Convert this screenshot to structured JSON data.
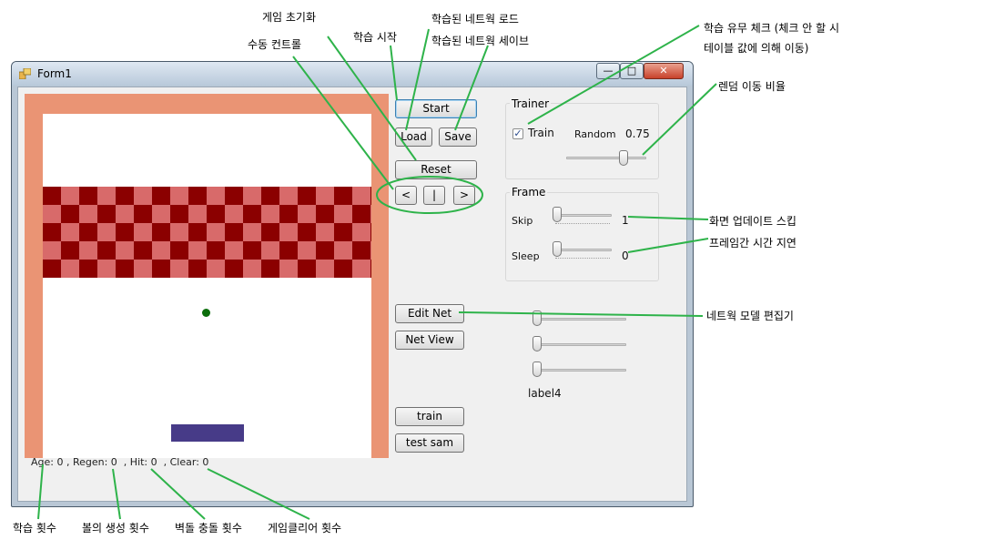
{
  "window": {
    "title": "Form1",
    "minimize": "—",
    "maximize": "□",
    "close": "✕"
  },
  "buttons": {
    "start": "Start",
    "load": "Load",
    "save": "Save",
    "reset": "Reset",
    "prev": "<",
    "pause": "|",
    "next": ">",
    "edit_net": "Edit Net",
    "net_view": "Net View",
    "train": "train",
    "test_sam": "test sam"
  },
  "trainer": {
    "title": "Trainer",
    "train_label": "Train",
    "train_checked": true,
    "random_label": "Random",
    "random_value": "0.75"
  },
  "frame": {
    "title": "Frame",
    "skip_label": "Skip",
    "skip_value": "1",
    "sleep_label": "Sleep",
    "sleep_value": "0"
  },
  "extra": {
    "label4": "label4"
  },
  "status": {
    "text": "Age: 0 , Regen: 0  , Hit: 0  , Clear: 0"
  },
  "colors": {
    "wall": "#ea9474",
    "brick_dark": "#8b0000",
    "brick_light": "#d86a6a",
    "ball": "#0b6e0b",
    "paddle": "#473b88",
    "annotation_line": "#2eb34a"
  },
  "annotations": {
    "game_reset": "게임 초기화",
    "manual_control": "수동 컨트롤",
    "learn_start": "학습 시작",
    "net_load": "학습된 네트웍 로드",
    "net_save": "학습된 네트웍 세이브",
    "train_check_1": "학습 유무 체크 (체크 안 할 시",
    "train_check_2": "테이블 값에 의해 이동)",
    "random_ratio": "렌덤 이동 비율",
    "screen_skip": "화면 업데이트 스킵",
    "frame_delay": "프레임간 시간 지연",
    "net_editor": "네트웍 모델 편집기",
    "learn_count": "학습 횟수",
    "ball_regen": "볼의 생성 횟수",
    "wall_hits": "벽돌 충돌 횟수",
    "game_clear": "게임클리어 횟수"
  }
}
